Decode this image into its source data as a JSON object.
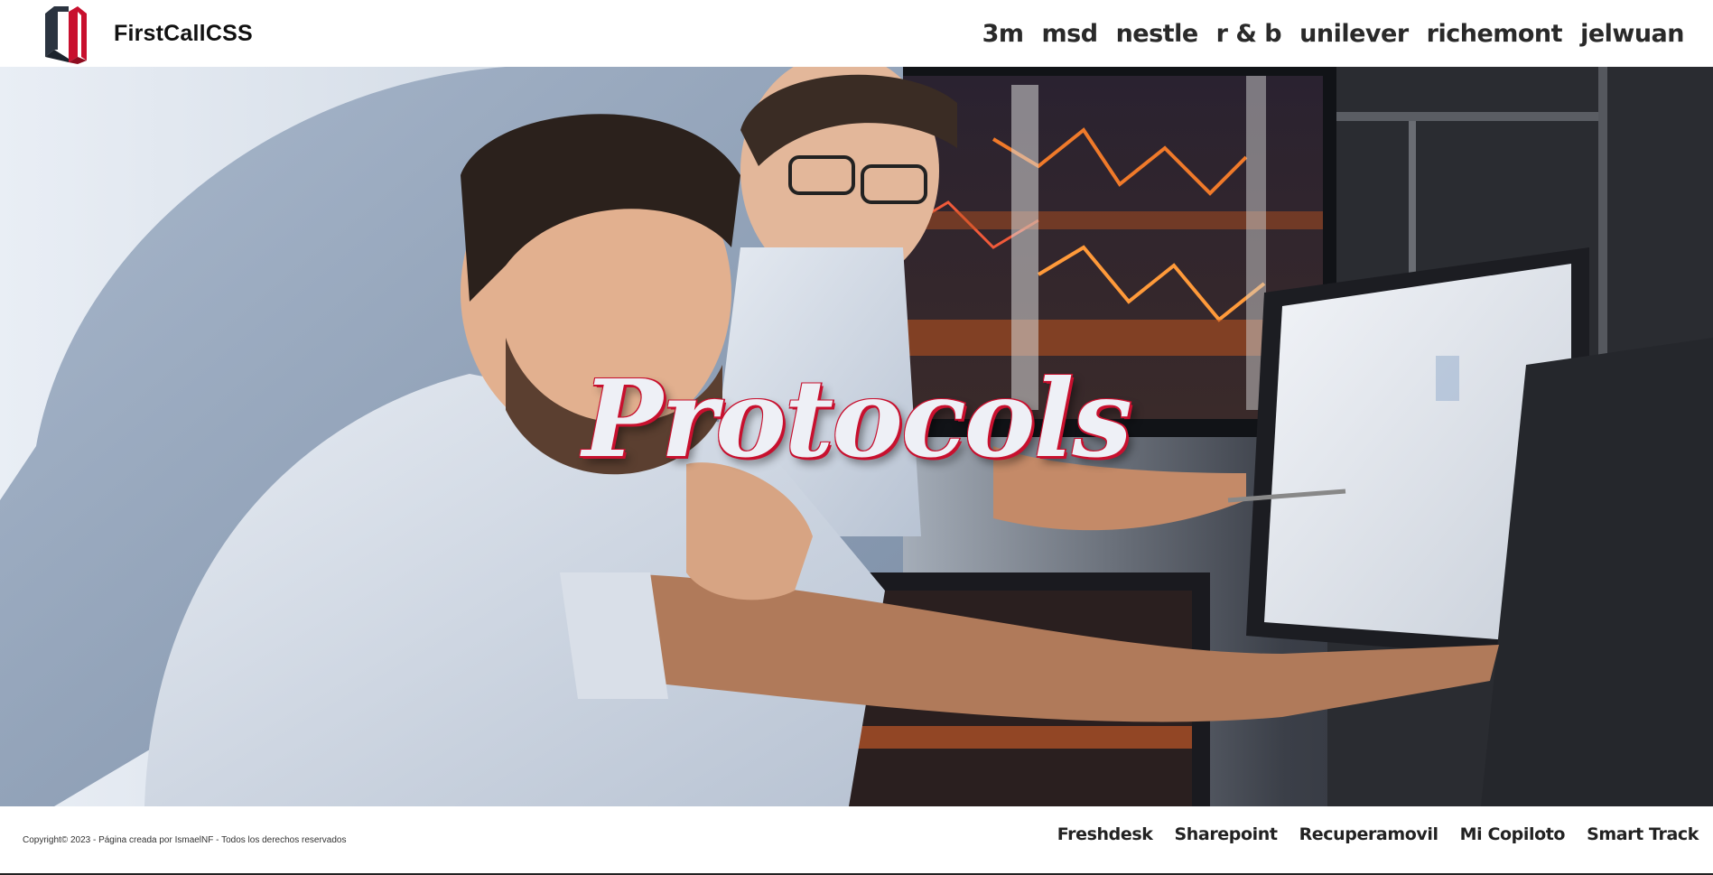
{
  "header": {
    "brand_name": "FirstCallCSS",
    "logo_icon": "firstcall-logo-icon",
    "nav": [
      {
        "label": "3m"
      },
      {
        "label": "msd"
      },
      {
        "label": "nestle"
      },
      {
        "label": "r & b"
      },
      {
        "label": "unilever"
      },
      {
        "label": "richemont"
      },
      {
        "label": "jelwuan"
      }
    ]
  },
  "hero": {
    "title": "Protocols",
    "image": "traders-at-monitors-photo"
  },
  "footer": {
    "copyright": "Copyright© 2023 - Página creada por IsmaelNF - Todos los derechos reservados",
    "links": [
      {
        "label": "Freshdesk"
      },
      {
        "label": "Sharepoint"
      },
      {
        "label": "Recuperamovil"
      },
      {
        "label": "Mi Copiloto"
      },
      {
        "label": "Smart Track"
      }
    ]
  },
  "colors": {
    "accent_red": "#c8102e",
    "logo_dark": "#2b3440",
    "text_dark": "#2a2a2a"
  }
}
